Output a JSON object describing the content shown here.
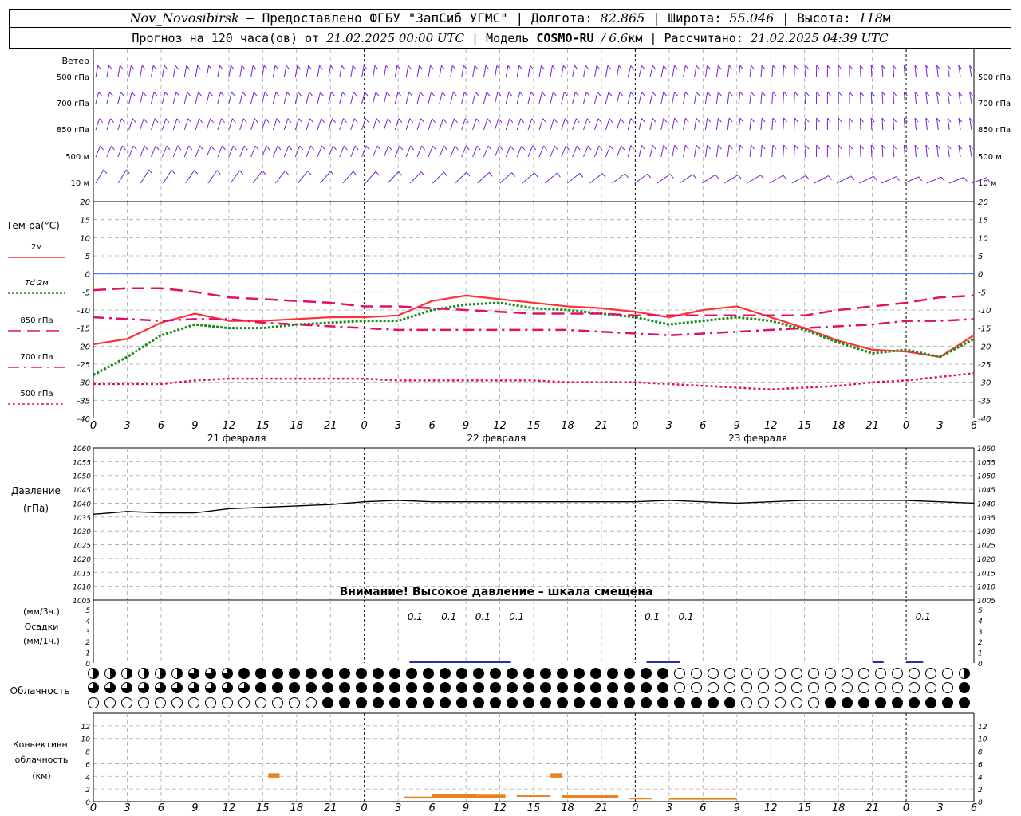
{
  "header": {
    "station": "Nov_Novosibirsk",
    "provider": "– Предоставлено ФГБУ \"ЗапСиб УГМС\"",
    "lon_label": "Долгота:",
    "lon_value": "82.865",
    "lat_label": "Широта:",
    "lat_value": "55.046",
    "alt_label": "Высота:",
    "alt_value": "118",
    "alt_unit": "м",
    "forecast_prefix": "Прогноз на 120 часа(ов) от",
    "forecast_time": "21.02.2025 00:00 UTC",
    "model_label": "Модель",
    "model_name": "COSMO-RU",
    "model_res": "/ 6.6",
    "model_res_unit": "км",
    "calc_label": "Рассчитано:",
    "calc_time": "21.02.2025 04:39 UTC"
  },
  "time_axis": {
    "hour_labels": [
      "0",
      "3",
      "6",
      "9",
      "12",
      "15",
      "18",
      "21",
      "0",
      "3",
      "6",
      "9",
      "12",
      "15",
      "18",
      "21",
      "0",
      "3",
      "6",
      "9",
      "12",
      "15",
      "18",
      "21",
      "0",
      "3",
      "6"
    ],
    "dates": [
      "21 февраля",
      "22 февраля",
      "23 февраля"
    ]
  },
  "wind": {
    "title": "Ветер",
    "levels": [
      "500 гПа",
      "700 гПа",
      "850 гПа",
      "500 м",
      "10 м"
    ],
    "color": "#7b1fd6"
  },
  "pressure": {
    "label1": "Давление",
    "label2": "(гПа)",
    "warning": "Внимание! Высокое давление – шкала смещена"
  },
  "precip": {
    "label1": "(мм/3ч.)",
    "label2": "Осадки",
    "label3": "(мм/1ч.)",
    "values_label": "0.1"
  },
  "cloud": {
    "label": "Облачность"
  },
  "convective": {
    "label1": "Конвективн.",
    "label2": "облачность",
    "label3": "(км)",
    "color": "#e8821e"
  },
  "legend": {
    "title": "Тем-ра(°С)",
    "items": [
      {
        "label": "2м",
        "color": "#ff3333"
      },
      {
        "label": "Td  2м",
        "color": "#1a8a1a"
      },
      {
        "label": "850 гПа",
        "color": "#e0106a"
      },
      {
        "label": "700 гПа",
        "color": "#e0106a"
      },
      {
        "label": "500 гПа",
        "color": "#e0106a"
      }
    ]
  },
  "chart_data": [
    {
      "type": "line",
      "title": "Тем-ра(°С)",
      "x_hours": [
        0,
        3,
        6,
        9,
        12,
        15,
        18,
        21,
        24,
        27,
        30,
        33,
        36,
        39,
        42,
        45,
        48,
        51,
        54,
        57,
        60,
        63,
        66,
        69,
        72,
        75,
        78
      ],
      "ylim": [
        -40,
        20
      ],
      "yticks": [
        20,
        15,
        10,
        5,
        0,
        -5,
        -10,
        -15,
        -20,
        -25,
        -30,
        -35,
        -40
      ],
      "series": [
        {
          "name": "2м",
          "values": [
            -19.5,
            -18,
            -13.5,
            -11,
            -13,
            -13,
            -12.5,
            -12,
            -12,
            -11.5,
            -7.5,
            -6,
            -7,
            -8,
            -9,
            -9.5,
            -10.5,
            -12,
            -10,
            -9,
            -12,
            -15,
            -18.5,
            -21,
            -21.5,
            -23,
            -17
          ]
        },
        {
          "name": "Td 2м",
          "values": [
            -28,
            -23,
            -17,
            -14,
            -15,
            -15,
            -14,
            -13.5,
            -13,
            -13,
            -10,
            -8.5,
            -8,
            -9.5,
            -10,
            -11,
            -12,
            -14,
            -13,
            -12,
            -13,
            -15.5,
            -19,
            -22,
            -21,
            -23,
            -18
          ]
        },
        {
          "name": "850 гПа",
          "values": [
            -4.5,
            -4,
            -4,
            -5,
            -6.5,
            -7,
            -7.5,
            -8,
            -9,
            -9,
            -9.5,
            -10,
            -10.5,
            -11,
            -11,
            -11,
            -11.5,
            -11.5,
            -11.5,
            -11.5,
            -11.5,
            -11.5,
            -10,
            -9,
            -8,
            -6.5,
            -6
          ]
        },
        {
          "name": "700 гПа",
          "values": [
            -12,
            -12.5,
            -13,
            -12.5,
            -12.5,
            -13.5,
            -14,
            -14.5,
            -15,
            -15.5,
            -15.5,
            -15.5,
            -15.5,
            -15.5,
            -15.5,
            -16,
            -16.5,
            -17,
            -16.5,
            -16,
            -15.5,
            -15,
            -14.5,
            -14,
            -13,
            -13,
            -12.5
          ]
        },
        {
          "name": "500 гПа",
          "values": [
            -30.5,
            -30.5,
            -30.5,
            -29.5,
            -29,
            -29,
            -29,
            -29,
            -29,
            -29.5,
            -29.5,
            -29.5,
            -29.5,
            -29.5,
            -30,
            -30,
            -30,
            -30.5,
            -31,
            -31.5,
            -32,
            -31.5,
            -31,
            -30,
            -29.5,
            -28.5,
            -27.5
          ]
        }
      ]
    },
    {
      "type": "line",
      "title": "Давление (гПа)",
      "x_hours": [
        0,
        3,
        6,
        9,
        12,
        15,
        18,
        21,
        24,
        27,
        30,
        33,
        36,
        39,
        42,
        45,
        48,
        51,
        54,
        57,
        60,
        63,
        66,
        69,
        72,
        75,
        78
      ],
      "ylim": [
        1005,
        1060
      ],
      "yticks": [
        1060,
        1055,
        1050,
        1045,
        1040,
        1035,
        1030,
        1025,
        1020,
        1015,
        1010,
        1005
      ],
      "series": [
        {
          "name": "Давление",
          "values": [
            1036,
            1037,
            1036.5,
            1036.5,
            1038,
            1038.5,
            1039,
            1039.5,
            1040.5,
            1041,
            1040.5,
            1040.5,
            1040.5,
            1040.5,
            1040.5,
            1040.5,
            1040.5,
            1041,
            1040.5,
            1040,
            1040.5,
            1041,
            1041,
            1041,
            1041,
            1040.5,
            1040
          ]
        }
      ]
    },
    {
      "type": "bar",
      "title": "Осадки",
      "ylim": [
        0,
        5
      ],
      "yticks": [
        5,
        4,
        3,
        2,
        1,
        0
      ],
      "labels": [
        {
          "hour": 28.5,
          "text": "0.1"
        },
        {
          "hour": 31.5,
          "text": "0.1"
        },
        {
          "hour": 34.5,
          "text": "0.1"
        },
        {
          "hour": 37.5,
          "text": "0.1"
        },
        {
          "hour": 49.5,
          "text": "0.1"
        },
        {
          "hour": 52.5,
          "text": "0.1"
        },
        {
          "hour": 73.5,
          "text": "0.1"
        }
      ]
    },
    {
      "type": "bar",
      "title": "Конвективн. облачность (км)",
      "ylim": [
        0,
        14
      ],
      "yticks": [
        12,
        10,
        8,
        6,
        4,
        2,
        0
      ],
      "segments": [
        {
          "from": 15.5,
          "to": 16.5,
          "bottom": 3.8,
          "top": 4.5
        },
        {
          "from": 40.5,
          "to": 41.5,
          "bottom": 3.8,
          "top": 4.5
        },
        {
          "from": 27.5,
          "to": 30.0,
          "bottom": 0.5,
          "top": 0.8
        },
        {
          "from": 30.0,
          "to": 34.0,
          "bottom": 0.5,
          "top": 1.2
        },
        {
          "from": 34.0,
          "to": 36.5,
          "bottom": 0.5,
          "top": 1.1
        },
        {
          "from": 37.5,
          "to": 40.5,
          "bottom": 0.8,
          "top": 1.0
        },
        {
          "from": 41.5,
          "to": 46.5,
          "bottom": 0.6,
          "top": 1.0
        },
        {
          "from": 47.5,
          "to": 49.5,
          "bottom": 0.4,
          "top": 0.6
        },
        {
          "from": 51.0,
          "to": 57.0,
          "bottom": 0.3,
          "top": 0.6
        }
      ]
    }
  ]
}
